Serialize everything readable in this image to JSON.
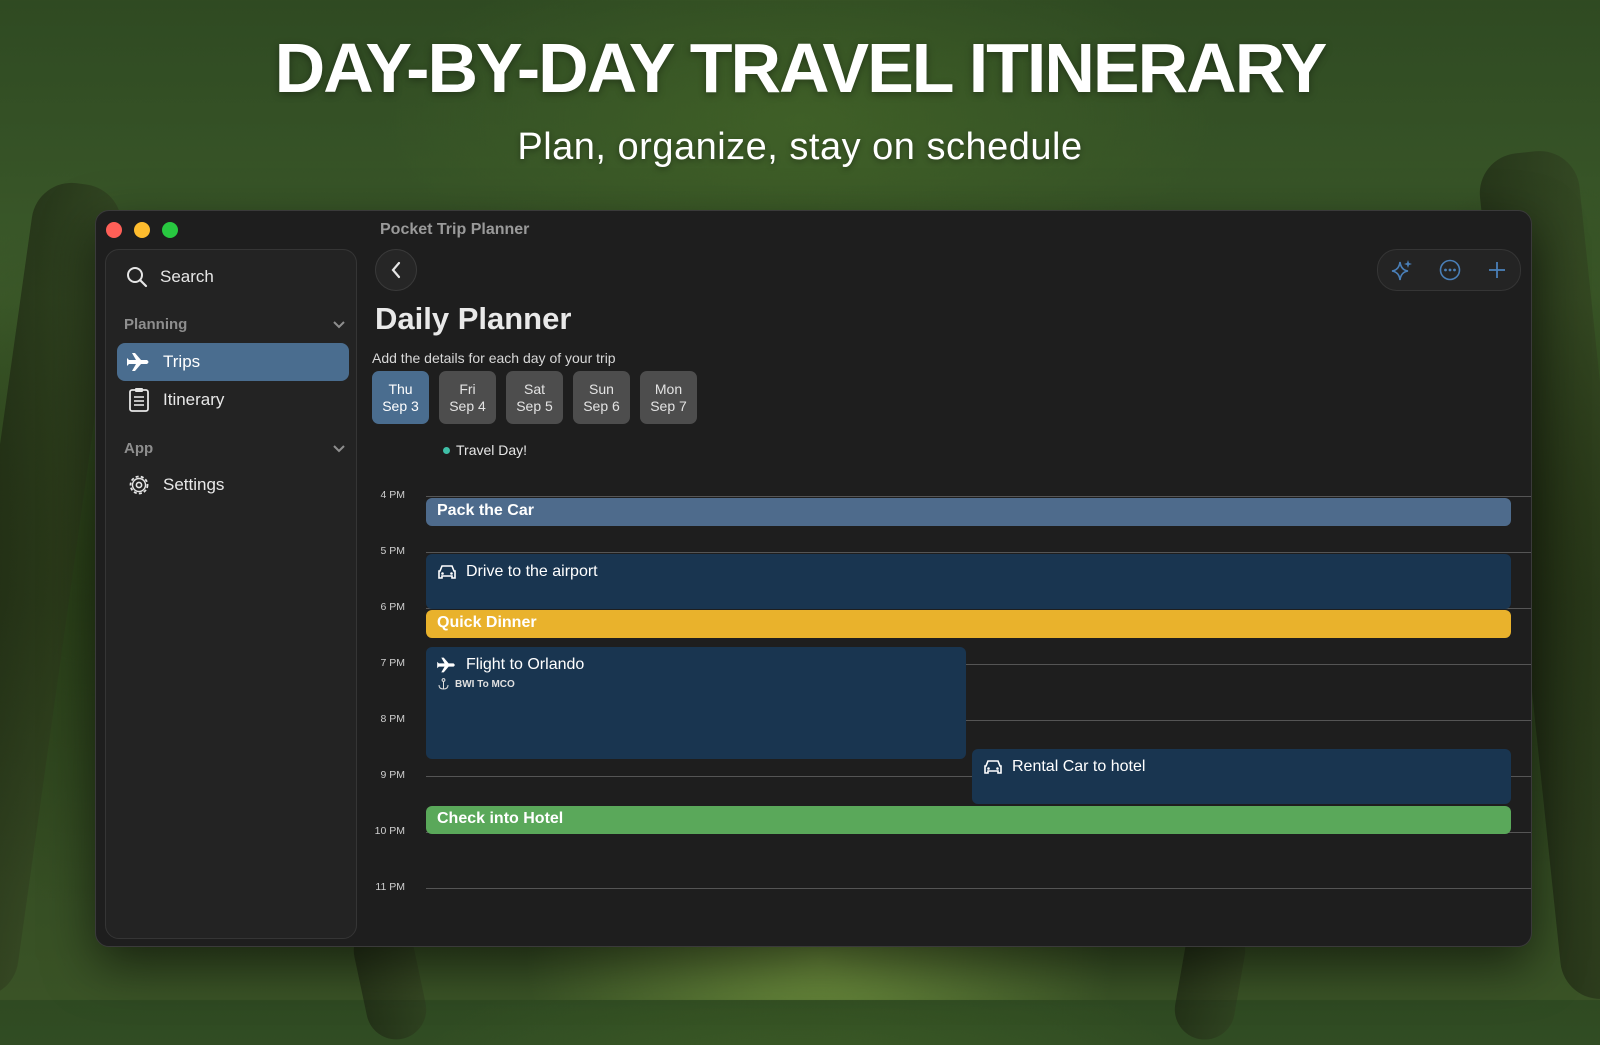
{
  "hero": {
    "title": "DAY-BY-DAY TRAVEL ITINERARY",
    "subtitle": "Plan, organize, stay on schedule"
  },
  "window": {
    "title": "Pocket Trip Planner",
    "traffic_colors": [
      "#fe5f57",
      "#febc2e",
      "#28c840"
    ]
  },
  "sidebar": {
    "search_label": "Search",
    "sections": [
      {
        "label": "Planning",
        "items": [
          {
            "label": "Trips",
            "icon": "airplane-icon",
            "active": true
          },
          {
            "label": "Itinerary",
            "icon": "clipboard-icon",
            "active": false
          }
        ]
      },
      {
        "label": "App",
        "items": [
          {
            "label": "Settings",
            "icon": "gear-icon",
            "active": false
          }
        ]
      }
    ]
  },
  "toolbar": {
    "buttons": [
      "sparkles-icon",
      "more-icon",
      "plus-icon"
    ],
    "accent": "#4a6d8f"
  },
  "planner": {
    "title": "Daily Planner",
    "subtitle": "Add the details for each day of your trip",
    "days": [
      {
        "weekday": "Thu",
        "date": "Sep 3",
        "active": true
      },
      {
        "weekday": "Fri",
        "date": "Sep 4",
        "active": false
      },
      {
        "weekday": "Sat",
        "date": "Sep 5",
        "active": false
      },
      {
        "weekday": "Sun",
        "date": "Sep 6",
        "active": false
      },
      {
        "weekday": "Mon",
        "date": "Sep 7",
        "active": false
      }
    ],
    "note": "Travel Day!",
    "hours": [
      "4 PM",
      "5 PM",
      "6 PM",
      "7 PM",
      "8 PM",
      "9 PM",
      "10 PM",
      "11 PM"
    ],
    "events": [
      {
        "title": "Pack the Car",
        "start": "4 PM",
        "color": "#4e6b8c"
      },
      {
        "title": "Drive to the airport",
        "icon": "car-icon",
        "start": "5 PM",
        "color": "#193550"
      },
      {
        "title": "Quick Dinner",
        "start": "6 PM",
        "color": "#e9b22c"
      },
      {
        "title": "Flight to Orlando",
        "icon": "airplane-icon",
        "detail": "BWI To MCO",
        "detail_icon": "anchor-icon",
        "start": "7 PM",
        "color": "#193550"
      },
      {
        "title": "Rental Car to hotel",
        "icon": "car-icon",
        "start": "9 PM",
        "color": "#193550"
      },
      {
        "title": "Check into Hotel",
        "start": "10 PM",
        "color": "#5aa85a"
      }
    ]
  }
}
